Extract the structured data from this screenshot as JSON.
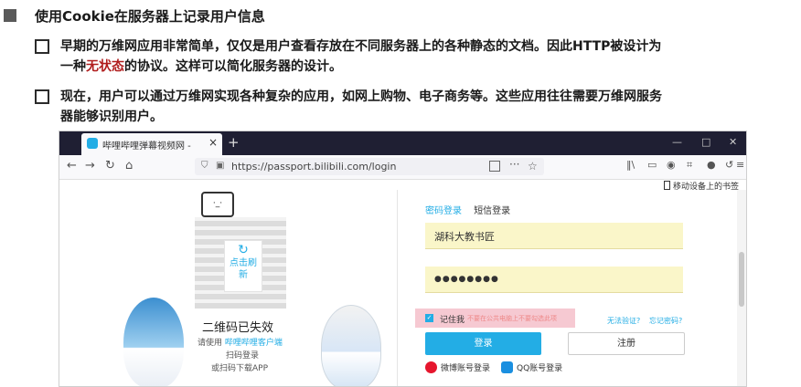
{
  "slide": {
    "heading": "使用Cookie在服务器上记录用户信息",
    "bullet1": {
      "line1": "早期的万维网应用非常简单，仅仅是用户查看存放在不同服务器上的各种静态的文档。因此HTTP被设计为",
      "line2_pre": "一种",
      "line2_highlight": "无状态",
      "line2_post": "的协议。这样可以简化服务器的设计。"
    },
    "bullet2": {
      "line1": "现在，用户可以通过万维网实现各种复杂的应用，如网上购物、电子商务等。这些应用往往需要万维网服务",
      "line2": "器能够识别用户。"
    }
  },
  "browser": {
    "tab_title": "哔哩哔哩弹幕视频网 - (゜-゜)",
    "tab_close": "×",
    "new_tab": "+",
    "win_minimize": "—",
    "win_maximize": "□",
    "win_close": "✕",
    "url": "https://passport.bilibili.com/login",
    "bookmark_text": "移动设备上的书签",
    "page": {
      "mascot_face": "·_·",
      "qr_refresh_line1": "点击刷",
      "qr_refresh_line2": "新",
      "qr_expired": "二维码已失效",
      "qr_use_prefix": "请使用 ",
      "qr_use_link": "哔哩哔哩客户端",
      "qr_scan": "扫码登录",
      "qr_download": "或扫码下载APP",
      "tab_password": "密码登录",
      "tab_sms": "短信登录",
      "username_value": "湖科大教书匠",
      "password_value": "●●●●●●●●",
      "remember_label": "记住我",
      "remember_hint": "不要在公共电脑上不要勾选此项",
      "cant_verify": "无法验证?",
      "forgot_password": "忘记密码?",
      "login_button": "登录",
      "register_button": "注册",
      "weibo_login": "微博账号登录",
      "qq_login": "QQ账号登录"
    }
  },
  "colors": {
    "accent": "#23ade5",
    "highlight": "#b01c1c",
    "field_bg": "#faf6c9",
    "remember_bg": "#f6c9d2"
  }
}
